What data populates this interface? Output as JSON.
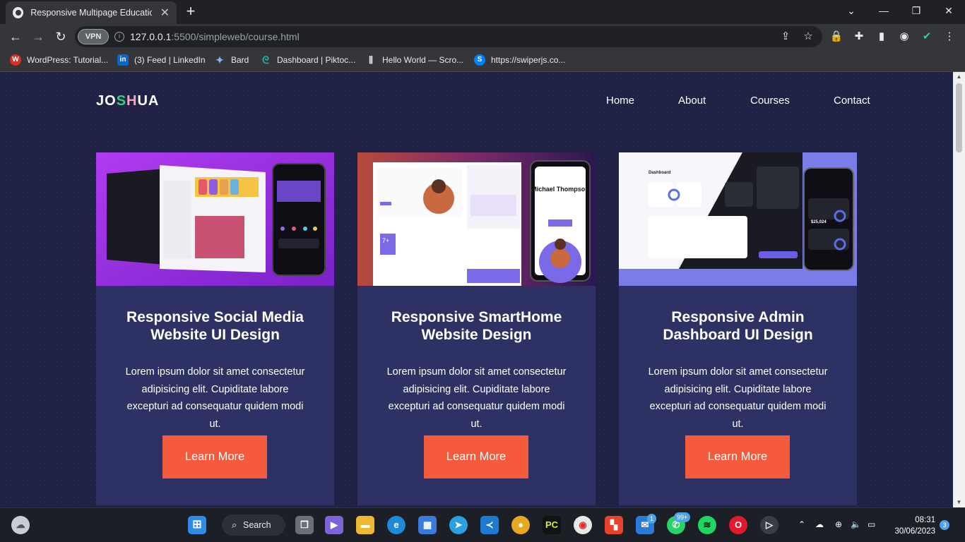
{
  "browser": {
    "tab_title": "Responsive Multipage Education",
    "tab_close": "✕",
    "new_tab": "+",
    "vpn_label": "VPN",
    "url_host": "127.0.0.1",
    "url_rest": ":5500/simpleweb/course.html",
    "bookmarks": [
      {
        "label": "WordPress: Tutorial...",
        "icon": "wordpress-icon",
        "color": "#d93025"
      },
      {
        "label": "(3) Feed | LinkedIn",
        "icon": "linkedin-icon",
        "color": "#0a66c2"
      },
      {
        "label": "Bard",
        "icon": "bard-icon",
        "color": "#8ab4f8"
      },
      {
        "label": "Dashboard | Piktoc...",
        "icon": "piktochart-icon",
        "color": "#1fb4a2"
      },
      {
        "label": "Hello World — Scro...",
        "icon": "scrollbar-icon",
        "color": "#e8eaed"
      },
      {
        "label": "https://swiperjs.co...",
        "icon": "swiper-icon",
        "color": "#0080ff"
      }
    ]
  },
  "site": {
    "logo_part1": "JO",
    "logo_part2": "S",
    "logo_part3": "H",
    "logo_part4": "UA",
    "nav": [
      "Home",
      "About",
      "Courses",
      "Contact"
    ],
    "courses": [
      {
        "title": "Responsive Social Media Website UI Design",
        "description": "Lorem ipsum dolor sit amet consectetur adipisicing elit. Cupiditate labore excepturi ad consequatur quidem modi ut.",
        "button": "Learn More"
      },
      {
        "title": "Responsive SmartHome Website Design",
        "description": "Lorem ipsum dolor sit amet consectetur adipisicing elit. Cupiditate labore excepturi ad consequatur quidem modi ut.",
        "button": "Learn More"
      },
      {
        "title": "Responsive Admin Dashboard UI Design",
        "description": "Lorem ipsum dolor sit amet consectetur adipisicing elit. Cupiditate labore excepturi ad consequatur quidem modi ut.",
        "button": "Learn More"
      }
    ],
    "thumb2_name": "Michael Thompson",
    "thumb3_title": "Dashboard",
    "thumb3_value": "$25,024",
    "thumb2_badge": "7+"
  },
  "taskbar": {
    "search_label": "Search",
    "mail_badge": "1",
    "whatsapp_badge": "99+",
    "notif_count": "3",
    "time": "08:31",
    "date": "30/06/2023"
  },
  "colors": {
    "page_bg": "#1f2245",
    "card_bg": "#2d3163",
    "button": "#f55a3c",
    "logo_s": "#35d07f",
    "logo_h": "#f7a4c4"
  }
}
